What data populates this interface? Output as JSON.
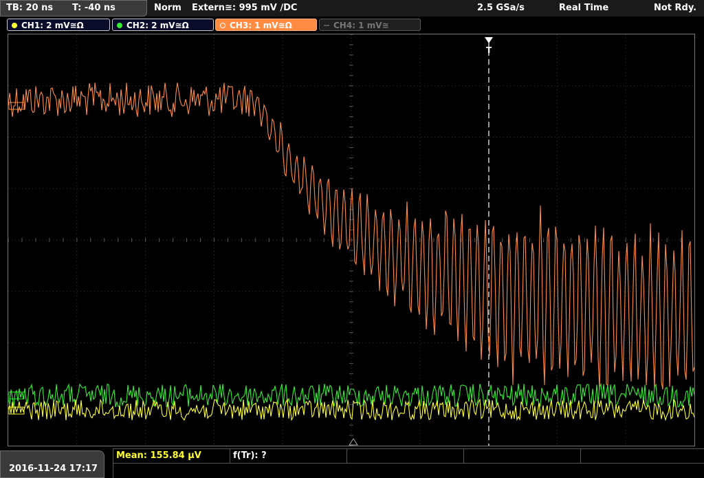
{
  "timebase": {
    "tb": "TB: 20 ns",
    "t": "T: -40 ns"
  },
  "status": {
    "mode": "Norm",
    "trigger": "Extern≅: 995 mV ∕DC",
    "sample_rate": "2.5 GSa/s",
    "acq": "Real Time",
    "state": "Not Rdy."
  },
  "channels": [
    {
      "label": "CH1: 2 mV≅Ω",
      "color": "#ffff33",
      "active": true
    },
    {
      "label": "CH2: 2 mV≅Ω",
      "color": "#33ee33",
      "active": true
    },
    {
      "label": "CH3: 1 mV≅Ω",
      "color": "#ff8c42",
      "active": true,
      "selected": true
    },
    {
      "label": "CH4: 1 mV≅",
      "color": "#777777",
      "active": false
    }
  ],
  "trigger_marker": "T",
  "footer": {
    "datetime": "2016-11-24 17:17",
    "measurement_1": "Mean: 155.84 µV",
    "measurement_2": "f(Tr): ?"
  },
  "colors": {
    "ch1": "#ffff33",
    "ch2": "#33ee33",
    "ch3": "#ff8c42",
    "grid": "#555555",
    "trigger_line": "#ffffff"
  }
}
